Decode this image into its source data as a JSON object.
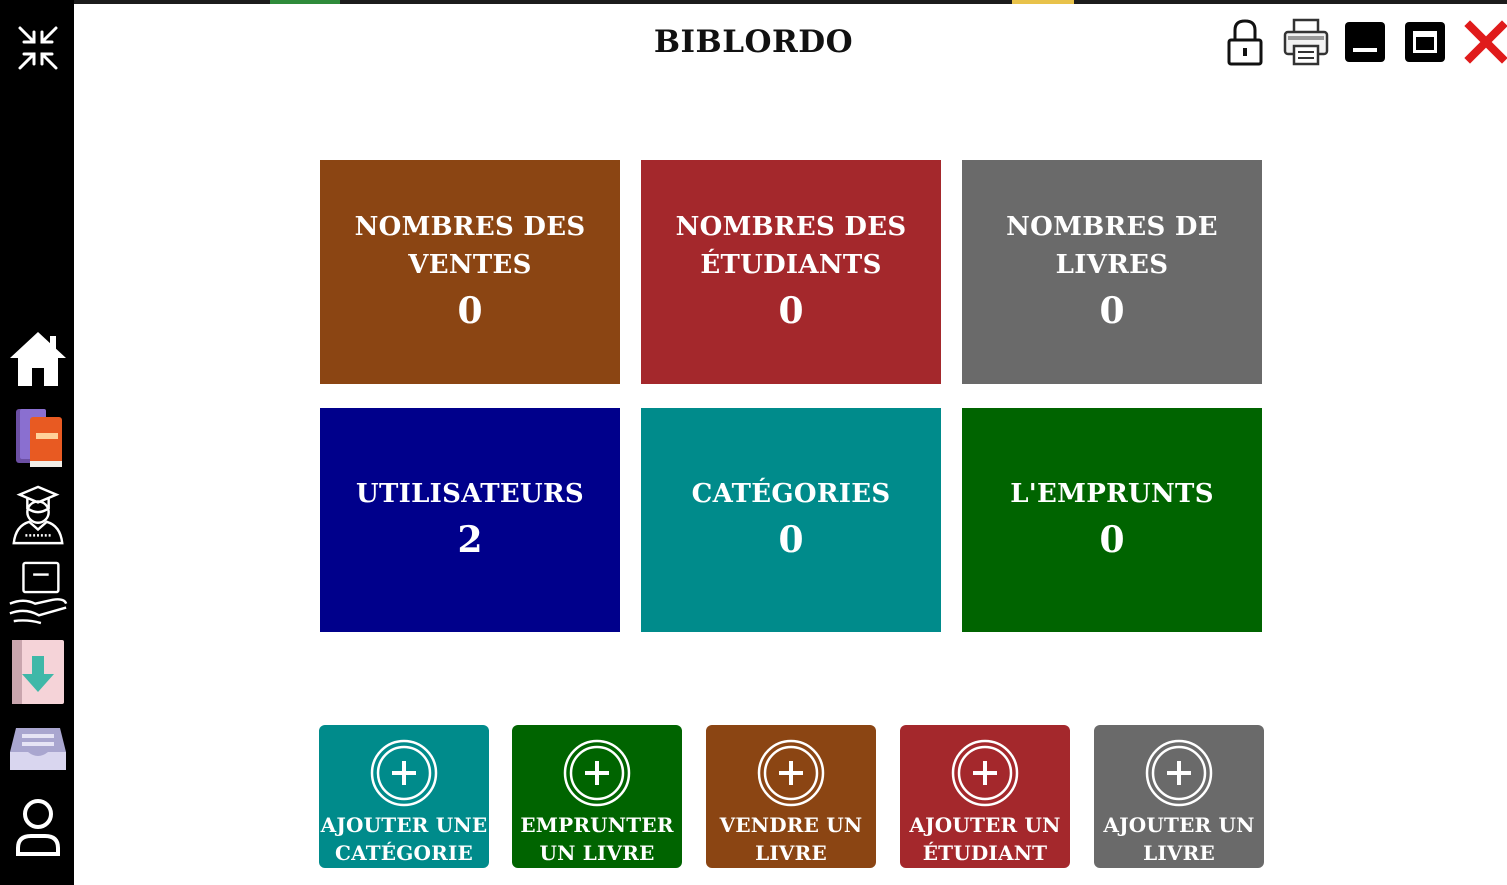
{
  "app": {
    "title": "BIBLORDO"
  },
  "colors": {
    "brown": "#8b4513",
    "red": "#a4282c",
    "gray": "#6a6a6a",
    "navy": "#00008b",
    "teal": "#008b8b",
    "green": "#006400",
    "sidebar": "#000000"
  },
  "window_controls": [
    {
      "name": "lock-icon"
    },
    {
      "name": "printer-icon"
    },
    {
      "name": "minimize-icon"
    },
    {
      "name": "maximize-icon"
    },
    {
      "name": "close-icon"
    }
  ],
  "sidebar": {
    "items": [
      {
        "name": "collapse-icon"
      },
      {
        "name": "home-icon"
      },
      {
        "name": "books-icon"
      },
      {
        "name": "student-icon"
      },
      {
        "name": "sale-icon"
      },
      {
        "name": "download-icon"
      },
      {
        "name": "inbox-icon"
      },
      {
        "name": "user-icon"
      }
    ]
  },
  "stats": [
    {
      "label": "NOMBRES DES\nVENTES",
      "value": "0",
      "color": "#8b4513"
    },
    {
      "label": "NOMBRES DES\nÉTUDIANTS",
      "value": "0",
      "color": "#a4282c"
    },
    {
      "label": "NOMBRES DE\nLIVRES",
      "value": "0",
      "color": "#6a6a6a"
    },
    {
      "label": "UTILISATEURS",
      "value": "2",
      "color": "#00008b"
    },
    {
      "label": "CATÉGORIES",
      "value": "0",
      "color": "#008b8b"
    },
    {
      "label": "L'EMPRUNTS",
      "value": "0",
      "color": "#006400"
    }
  ],
  "actions": [
    {
      "label": "AJOUTER UNE\nCATÉGORIE",
      "color": "#008b8b"
    },
    {
      "label": "EMPRUNTER\nUN LIVRE",
      "color": "#006400"
    },
    {
      "label": "VENDRE UN\nLIVRE",
      "color": "#8b4513"
    },
    {
      "label": "AJOUTER UN\nÉTUDIANT",
      "color": "#a4282c"
    },
    {
      "label": "AJOUTER UN\nLIVRE",
      "color": "#6a6a6a"
    }
  ]
}
